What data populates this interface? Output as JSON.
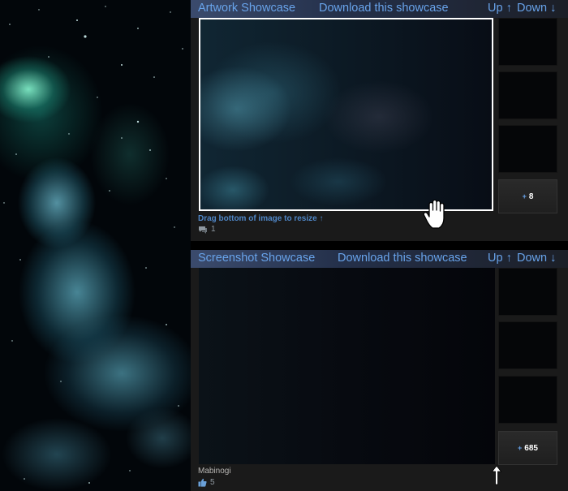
{
  "artwork_showcase": {
    "title": "Artwork Showcase",
    "download_label": "Download this showcase",
    "up_label": "Up ↑",
    "down_label": "Down ↓",
    "resize_hint": "Drag bottom of image to resize ↑",
    "comment_count": "1",
    "more_count": "8",
    "more_prefix": "+"
  },
  "screenshot_showcase": {
    "title": "Screenshot Showcase",
    "download_label": "Download this showcase",
    "up_label": "Up ↑",
    "down_label": "Down ↓",
    "game_name": "Mabinogi",
    "rating_count": "5",
    "more_count": "685",
    "more_prefix": "+"
  },
  "colors": {
    "link_blue": "#68a3ea",
    "panel_bg": "#1a1a1a",
    "header_start": "#3b4b6d"
  },
  "icons": {
    "comment": "speech-bubble-icon",
    "rating": "thumbs-up-icon",
    "cursor_top": "hand-grab-cursor",
    "cursor_bottom": "resize-up-arrow-cursor"
  }
}
